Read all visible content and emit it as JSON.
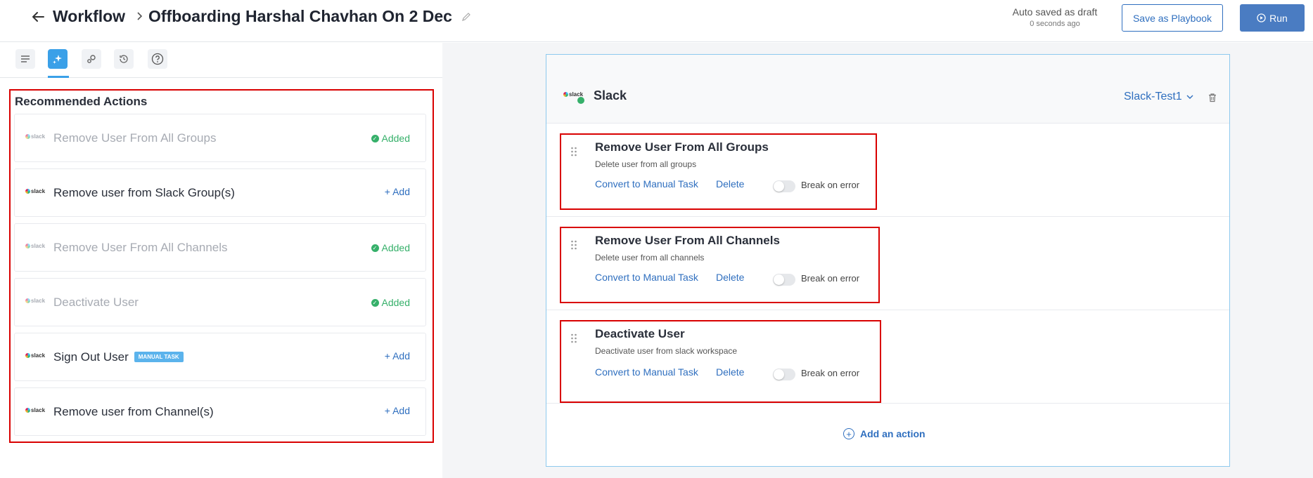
{
  "header": {
    "breadcrumb_root": "Workflow",
    "title": "Offboarding Harshal Chavhan On 2 Dec",
    "autosave_status": "Auto saved as draft",
    "autosave_time": "0 seconds ago",
    "save_playbook_label": "Save as Playbook",
    "run_label": "Run"
  },
  "left_panel": {
    "tabs": [
      {
        "icon": "list-icon",
        "active": false
      },
      {
        "icon": "sparkle-icon",
        "active": true
      },
      {
        "icon": "gears-icon",
        "active": false
      },
      {
        "icon": "history-icon",
        "active": false
      },
      {
        "icon": "help-icon",
        "active": false
      }
    ],
    "recommended_title": "Recommended Actions",
    "logo_text": "slack",
    "added_label": "Added",
    "add_label": "+ Add",
    "items": [
      {
        "label": "Remove User From All Groups",
        "status": "added"
      },
      {
        "label": "Remove user from Slack Group(s)",
        "status": "add"
      },
      {
        "label": "Remove User From All Channels",
        "status": "added"
      },
      {
        "label": "Deactivate User",
        "status": "added"
      },
      {
        "label": "Sign Out User",
        "status": "add",
        "badge": "MANUAL TASK"
      },
      {
        "label": "Remove user from Channel(s)",
        "status": "add"
      }
    ]
  },
  "canvas": {
    "app_name": "Slack",
    "app_logo_text": "slack",
    "account": "Slack-Test1",
    "convert_label": "Convert to Manual Task",
    "delete_label": "Delete",
    "break_label": "Break on error",
    "actions": [
      {
        "title": "Remove User From All Groups",
        "description": "Delete user from all groups"
      },
      {
        "title": "Remove User From All Channels",
        "description": "Delete user from all channels"
      },
      {
        "title": "Deactivate User",
        "description": "Deactivate user from slack workspace"
      }
    ],
    "add_action_label": "Add an action",
    "colors": {
      "accent": "#2f6fbf",
      "success": "#36b06a",
      "highlight": "#d90000",
      "tab_active": "#3aa0e8"
    }
  }
}
